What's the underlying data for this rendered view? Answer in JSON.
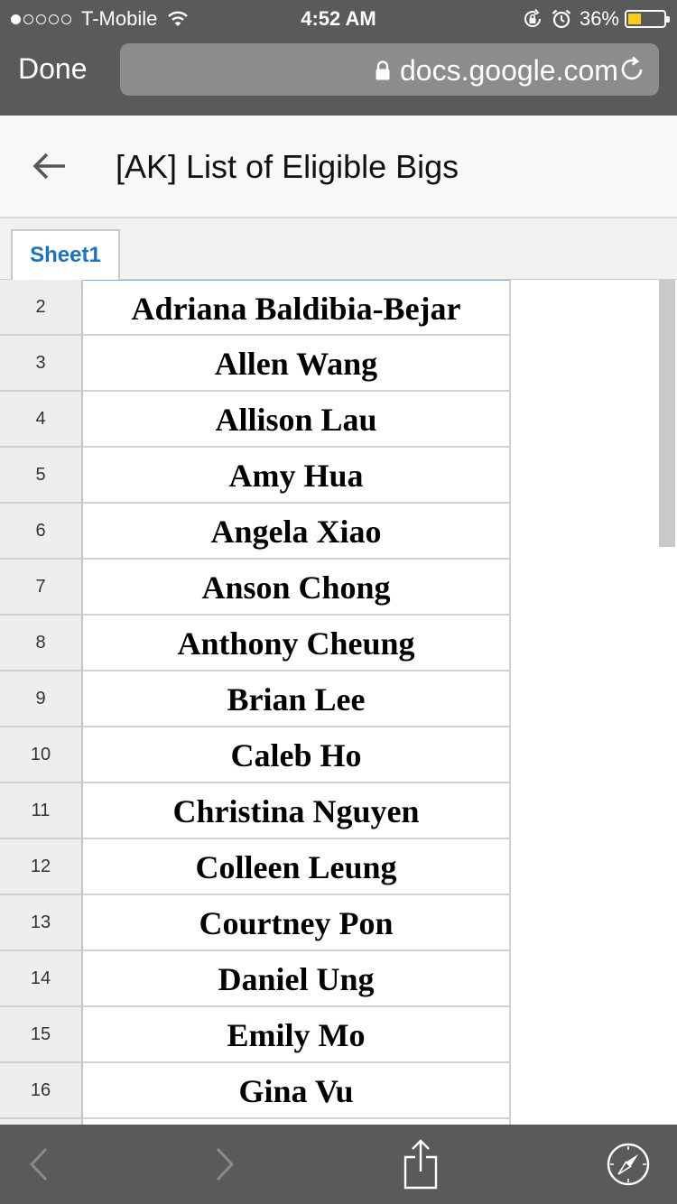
{
  "status_bar": {
    "carrier": "T-Mobile",
    "signal_bars_filled": 1,
    "signal_bars_total": 5,
    "time": "4:52 AM",
    "battery_percent": "36%",
    "battery_level": 0.36,
    "battery_color": "#f7ce1a",
    "icons": [
      "wifi-icon",
      "orientation-lock-icon",
      "alarm-icon",
      "battery-icon"
    ]
  },
  "browser": {
    "done_label": "Done",
    "url": "docs.google.com",
    "icons": [
      "lock-icon",
      "reload-icon"
    ]
  },
  "document": {
    "title": "[AK] List of Eligible Bigs",
    "back_icon": "back-arrow-icon"
  },
  "sheet_tabs": [
    {
      "label": "Sheet1",
      "active": true,
      "color": "#1a73c0"
    }
  ],
  "rows": [
    {
      "num": "2",
      "name": "Adriana Baldibia-Bejar"
    },
    {
      "num": "3",
      "name": "Allen Wang"
    },
    {
      "num": "4",
      "name": "Allison Lau"
    },
    {
      "num": "5",
      "name": "Amy Hua"
    },
    {
      "num": "6",
      "name": "Angela Xiao"
    },
    {
      "num": "7",
      "name": "Anson Chong"
    },
    {
      "num": "8",
      "name": "Anthony Cheung"
    },
    {
      "num": "9",
      "name": "Brian Lee"
    },
    {
      "num": "10",
      "name": "Caleb Ho"
    },
    {
      "num": "11",
      "name": "Christina Nguyen"
    },
    {
      "num": "12",
      "name": "Colleen Leung"
    },
    {
      "num": "13",
      "name": "Courtney Pon"
    },
    {
      "num": "14",
      "name": "Daniel Ung"
    },
    {
      "num": "15",
      "name": "Emily Mo"
    },
    {
      "num": "16",
      "name": "Gina Vu"
    }
  ],
  "toolbar": {
    "icons": [
      "back-chevron-icon",
      "forward-chevron-icon",
      "share-icon",
      "compass-icon"
    ]
  },
  "colors": {
    "chrome": "#5a5a5a",
    "urlbar": "#8c8c8c",
    "row_header_bg": "#eeeeee"
  }
}
